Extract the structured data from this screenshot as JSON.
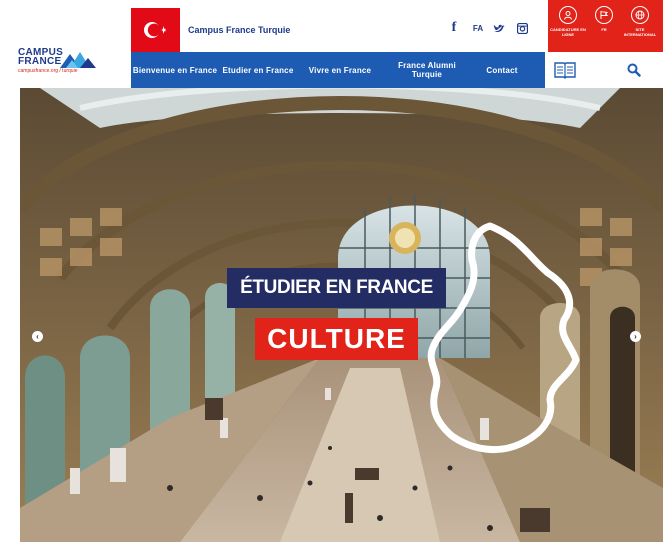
{
  "logo": {
    "line1": "CAMPUS",
    "line2": "FRANCE",
    "line3": "campusfrance.org / turquie"
  },
  "header": {
    "site_title": "Campus France Turquie"
  },
  "social": {
    "facebook": "f",
    "language": "FA"
  },
  "red_panel": [
    {
      "label": "CANDIDATURE EN LIGNE",
      "icon": "user-circle-icon"
    },
    {
      "label": "FR",
      "icon": "flag-circle-icon"
    },
    {
      "label": "SITE INTERNATIONAL",
      "icon": "globe-icon"
    }
  ],
  "nav": [
    {
      "label": "Bienvenue en France"
    },
    {
      "label": "Etudier en France"
    },
    {
      "label": "Vivre en France"
    },
    {
      "label": "France Alumni Turquie"
    },
    {
      "label": "Contact"
    }
  ],
  "hero": {
    "headline": "ÉTUDIER EN FRANCE",
    "subheadline": "CULTURE"
  },
  "colors": {
    "brand_blue": "#1e5cb3",
    "brand_red": "#e2231a",
    "dark_navy": "#232c63"
  }
}
